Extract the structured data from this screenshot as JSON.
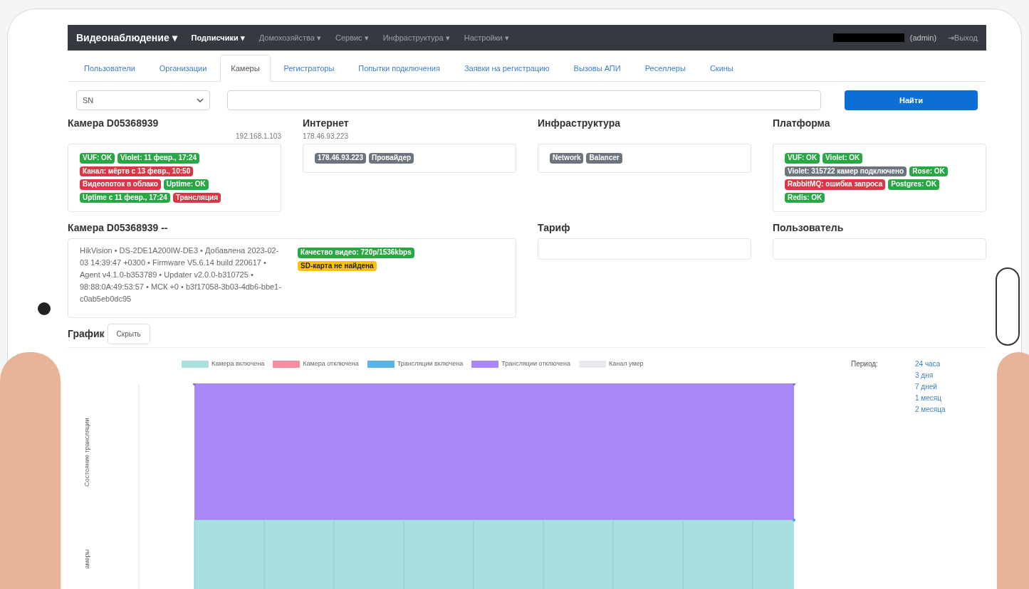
{
  "navbar": {
    "brand": "Видеонаблюдение ▾",
    "menus": [
      {
        "label": "Подписчики ▾",
        "selected": true
      },
      {
        "label": "Домохозяйства ▾",
        "selected": false
      },
      {
        "label": "Сервис ▾",
        "selected": false
      },
      {
        "label": "Инфраструктура ▾",
        "selected": false
      },
      {
        "label": "Настройки ▾",
        "selected": false
      }
    ],
    "user": "(admin)",
    "logout": "⇥Выход"
  },
  "tabs": [
    {
      "label": "Пользователи",
      "selected": false
    },
    {
      "label": "Организации",
      "selected": false
    },
    {
      "label": "Камеры",
      "selected": true
    },
    {
      "label": "Регистраторы",
      "selected": false
    },
    {
      "label": "Попытки подключения",
      "selected": false
    },
    {
      "label": "Заявки на регистрацию",
      "selected": false
    },
    {
      "label": "Вызовы АПИ",
      "selected": false
    },
    {
      "label": "Реселлеры",
      "selected": false
    },
    {
      "label": "Скины",
      "selected": false
    }
  ],
  "search": {
    "select": "SN",
    "button": "Найти"
  },
  "sections": [
    {
      "title": "Камера D05368939",
      "subtitle": "192.168.1.103",
      "badges": [
        {
          "text": "VUF: OK",
          "color": "#28a745"
        },
        {
          "text": "Violet: 11 февр., 17:24",
          "color": "#28a745"
        },
        {
          "text": "Канал: мёртв с 13 февр., 10:50",
          "color": "#dc3545"
        },
        {
          "text": "Видеопоток в облако",
          "color": "#dc3545"
        },
        {
          "text": "Uptime: OK",
          "color": "#28a745"
        },
        {
          "text": "Uptime с 11 февр., 17:24",
          "color": "#28a745"
        },
        {
          "text": "Трансляция",
          "color": "#dc3545"
        }
      ]
    },
    {
      "title": "Интернет",
      "subtitle": "178.46.93.223",
      "badges": [
        {
          "text": "178.46.93.223",
          "color": "#6c757d"
        },
        {
          "text": "Провайдер",
          "color": "#6c757d"
        }
      ]
    },
    {
      "title": "Инфраструктура",
      "badges": [
        {
          "text": "Network",
          "color": "#6c757d"
        },
        {
          "text": "Balancer",
          "color": "#6c757d"
        }
      ]
    },
    {
      "title": "Платформа",
      "badges": [
        {
          "text": "VUF: OK",
          "color": "#28a745"
        },
        {
          "text": "Violet: OK",
          "color": "#28a745"
        },
        {
          "text": "Violet: 315722 камер подключено",
          "color": "#6c757d"
        },
        {
          "text": "Rose: OK",
          "color": "#28a745"
        },
        {
          "text": "RabbitMQ: ошибка запроса",
          "color": "#dc3545"
        },
        {
          "text": "Postgres: OK",
          "color": "#28a745"
        },
        {
          "text": "Redis: OK",
          "color": "#28a745"
        }
      ]
    }
  ],
  "device": {
    "title": "Камера D05368939 --",
    "info": "HikVision • DS-2DE1A200IW-DE3 • Добавлена 2023-02-03 14:39:47 +0300 • Firmware V5.6.14 build 220617 • Agent v4.1.0-b353789 • Updater v2.0.0-b310725 • 98:88:0A:49:53:57 • МСК +0 • b3f17058-3b03-4db6-bbe1-c0ab5eb0dc95",
    "badges": [
      {
        "text": "Качество видео: 720p/1536kbps",
        "color": "#28a745"
      },
      {
        "text": "SD-карта не найдена",
        "color": "#ffc107"
      }
    ]
  },
  "tariff": {
    "title": "Тариф"
  },
  "user_panel": {
    "title": "Пользователь"
  },
  "graph": {
    "title": "График",
    "hide_button": "Скрыть",
    "legend": [
      {
        "label": "Камера включена",
        "color": "#a8dfdf"
      },
      {
        "label": "Камера отключена",
        "color": "#f58da0"
      },
      {
        "label": "Трансляции включена",
        "color": "#5cb3e8"
      },
      {
        "label": "Трансляции отключена",
        "color": "#a987f8"
      },
      {
        "label": "Канал умер",
        "color": "#e9ebee"
      }
    ],
    "axis_labels": [
      "Состояние трансляции",
      "амеры"
    ],
    "period_label": "Период:",
    "periods": [
      "24 часа",
      "3 дня",
      "7 дней",
      "1 месяц",
      "2 месяца"
    ]
  }
}
